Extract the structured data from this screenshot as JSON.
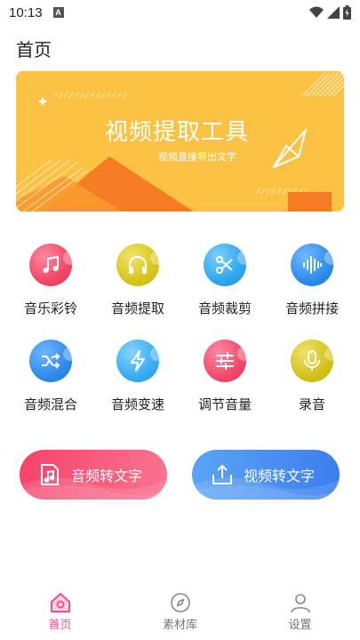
{
  "status_bar": {
    "time": "10:13",
    "notification_badge": "A"
  },
  "header": {
    "title": "首页"
  },
  "banner": {
    "title": "视频提取工具",
    "subtitle": "视频直接导出文字",
    "bg_color": "#FCC244",
    "accent_color": "#F57C22"
  },
  "features": [
    {
      "label": "音乐彩铃",
      "icon": "music-note-icon",
      "color": "#F44766"
    },
    {
      "label": "音频提取",
      "icon": "headphones-icon",
      "color": "#D6C61C"
    },
    {
      "label": "音频裁剪",
      "icon": "scissors-icon",
      "color": "#2EA6F0"
    },
    {
      "label": "音频拼接",
      "icon": "waveform-icon",
      "color": "#2E8EEA"
    },
    {
      "label": "音频混合",
      "icon": "shuffle-icon",
      "color": "#2F8CEC"
    },
    {
      "label": "音频变速",
      "icon": "lightning-icon",
      "color": "#38ACF2"
    },
    {
      "label": "调节音量",
      "icon": "sliders-icon",
      "color": "#F2486A"
    },
    {
      "label": "录音",
      "icon": "microphone-icon",
      "color": "#D3C21A"
    }
  ],
  "actions": {
    "audio_to_text": "音频转文字",
    "video_to_text": "视频转文字"
  },
  "bottom_nav": [
    {
      "label": "首页",
      "icon": "home-icon",
      "active": true
    },
    {
      "label": "素材库",
      "icon": "compass-icon",
      "active": false
    },
    {
      "label": "设置",
      "icon": "user-icon",
      "active": false
    }
  ]
}
